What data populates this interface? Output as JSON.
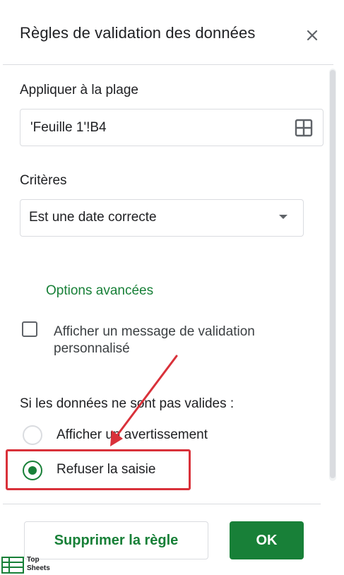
{
  "dialog": {
    "title": "Règles de validation des données",
    "close_icon": "close-icon"
  },
  "range": {
    "label": "Appliquer à la plage",
    "value": "'Feuille 1'!B4",
    "icon": "grid-select-icon"
  },
  "criteria": {
    "label": "Critères",
    "selected": "Est une date correcte",
    "icon": "dropdown-caret-icon"
  },
  "advanced": {
    "link": "Options avancées",
    "custom_message": {
      "checked": false,
      "label": "Afficher un message de validation personnalisé"
    }
  },
  "invalid_data": {
    "label": "Si les données ne sont pas valides :",
    "options": [
      {
        "label": "Afficher un avertissement",
        "selected": false
      },
      {
        "label": "Refuser la saisie",
        "selected": true
      }
    ]
  },
  "buttons": {
    "delete": "Supprimer la règle",
    "ok": "OK"
  },
  "annotation": {
    "arrow_color": "#d9313a",
    "highlight_color": "#d9313a"
  },
  "watermark": {
    "line1": "Top",
    "line2": "Sheets"
  },
  "colors": {
    "accent": "#188038",
    "border": "#dadce0",
    "text": "#202124"
  }
}
